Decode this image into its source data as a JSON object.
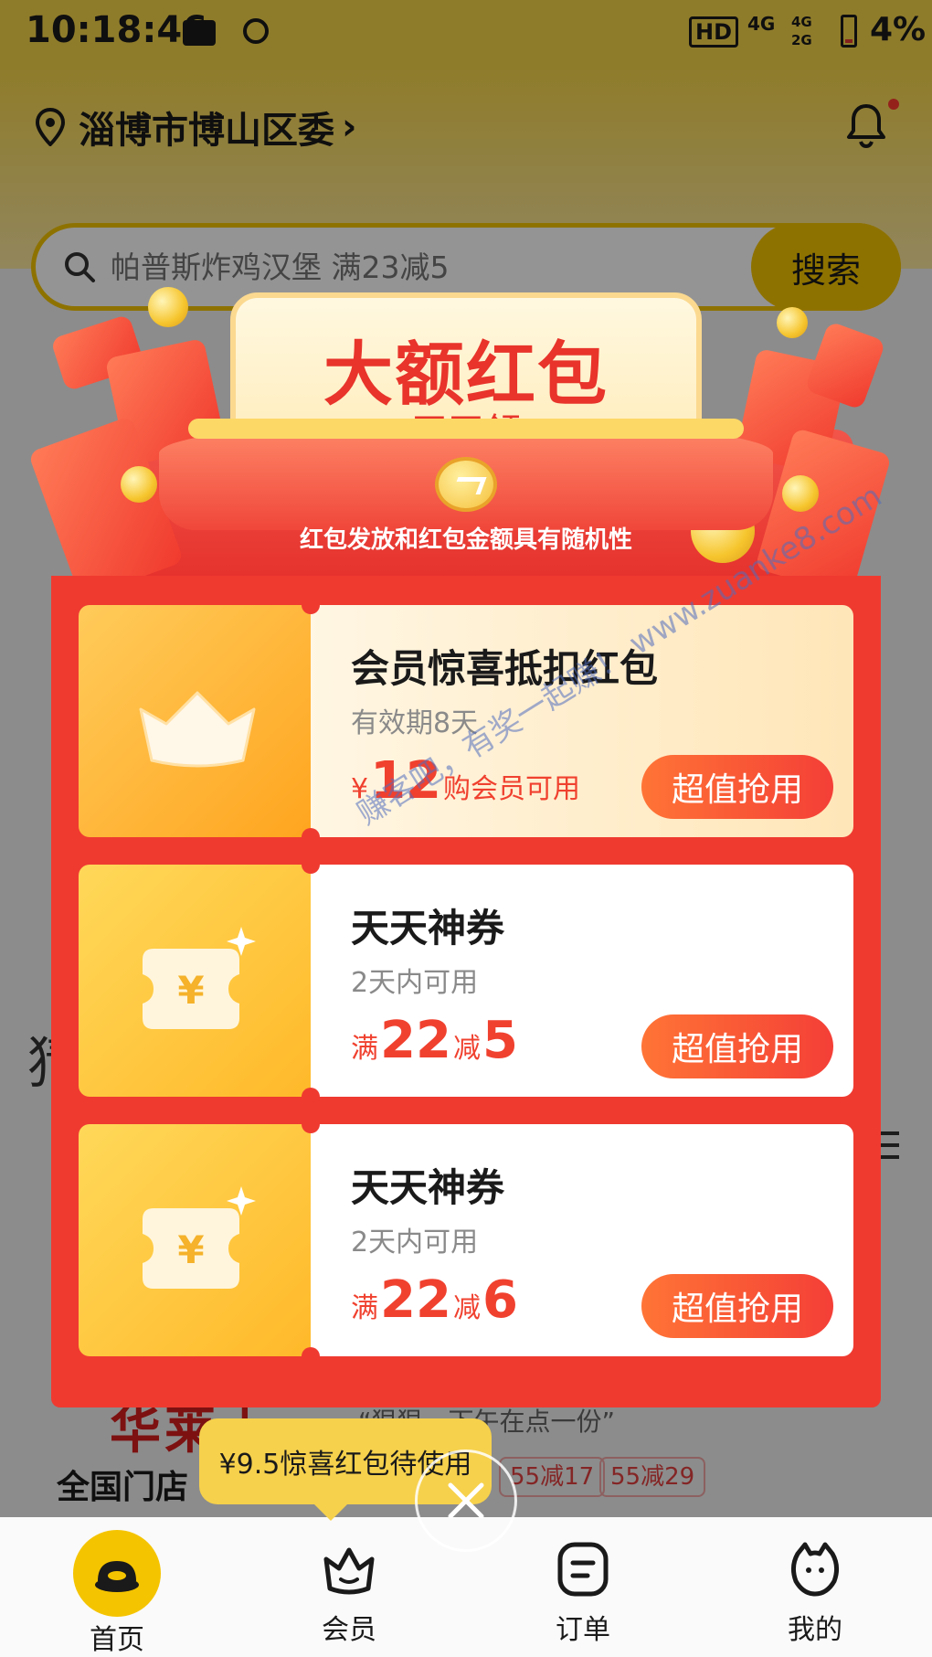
{
  "status_bar": {
    "time": "10:18:46",
    "hd": "HD",
    "signal_1": "4G",
    "signal_2": "4G",
    "signal_3": "2G",
    "battery": "4%"
  },
  "header": {
    "location": "淄博市博山区委",
    "location_chevron": "›"
  },
  "search": {
    "placeholder": "帕普斯炸鸡汉堡 满23减5",
    "button_label": "搜索"
  },
  "popup": {
    "title": "大额红包",
    "subtitle": "天天领",
    "disclaimer": "红包发放和红包金额具有随机性",
    "coupons": [
      {
        "title": "会员惊喜抵扣红包",
        "validity": "有效期8天",
        "prefix": "¥",
        "amount": "12",
        "suffix": "",
        "note": "购会员可用",
        "button": "超值抢用",
        "icon": "crown-icon"
      },
      {
        "title": "天天神券",
        "validity": "2天内可用",
        "prefix": "满",
        "amount": "22",
        "suffix": "减",
        "note": "5",
        "button": "超值抢用",
        "icon": "yen-ticket-icon"
      },
      {
        "title": "天天神券",
        "validity": "2天内可用",
        "prefix": "满",
        "amount": "22",
        "suffix": "减",
        "note": "6",
        "button": "超值抢用",
        "icon": "yen-ticket-icon"
      }
    ],
    "watermark": "赚客吧，有奖一起赚！ www.zuanke8.com"
  },
  "background": {
    "brand": "华莱士",
    "store_label": "全国门店",
    "slogan": "“狠狠一下午在点一份”",
    "tags": [
      "55减17",
      "55减29"
    ],
    "side_char": "猜"
  },
  "tooltip": {
    "text": "¥9.5惊喜红包待使用"
  },
  "tabbar": {
    "items": [
      {
        "label": "首页",
        "icon": "home-icon"
      },
      {
        "label": "会员",
        "icon": "member-crown-icon"
      },
      {
        "label": "订单",
        "icon": "order-icon"
      },
      {
        "label": "我的",
        "icon": "profile-icon"
      }
    ]
  },
  "colors": {
    "brand_yellow": "#f5c400",
    "popup_red": "#ef3a30",
    "price_red": "#f0412f",
    "button_gradient_start": "#ff7436",
    "button_gradient_end": "#f43f37"
  }
}
